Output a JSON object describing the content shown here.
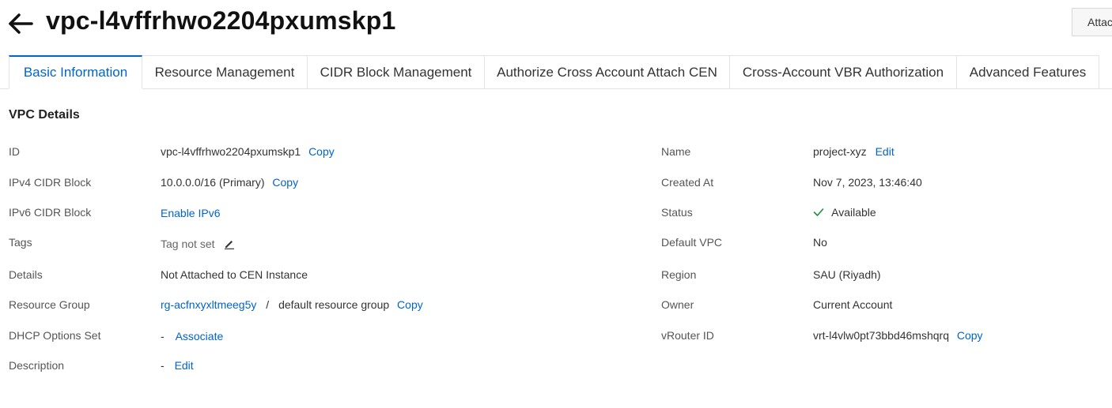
{
  "header": {
    "title": "vpc-l4vffrhwo2204pxumskp1",
    "back_icon": "arrow-left-icon",
    "attach_label": "Attac"
  },
  "tabs": [
    {
      "label": "Basic Information",
      "active": true
    },
    {
      "label": "Resource Management",
      "active": false
    },
    {
      "label": "CIDR Block Management",
      "active": false
    },
    {
      "label": "Authorize Cross Account Attach CEN",
      "active": false
    },
    {
      "label": "Cross-Account VBR Authorization",
      "active": false
    },
    {
      "label": "Advanced Features",
      "active": false
    }
  ],
  "section": {
    "title": "VPC Details"
  },
  "left": {
    "id": {
      "label": "ID",
      "value": "vpc-l4vffrhwo2204pxumskp1",
      "action": "Copy"
    },
    "ipv4": {
      "label": "IPv4 CIDR Block",
      "value": "10.0.0.0/16 (Primary)",
      "action": "Copy"
    },
    "ipv6": {
      "label": "IPv6 CIDR Block",
      "action": "Enable IPv6"
    },
    "tags": {
      "label": "Tags",
      "value": "Tag not set",
      "icon": "pencil-icon"
    },
    "details": {
      "label": "Details",
      "value": "Not Attached to CEN Instance"
    },
    "resource_group": {
      "label": "Resource Group",
      "link": "rg-acfnxyxltmeeg5y",
      "separator": "/",
      "value": "default resource group",
      "action": "Copy"
    },
    "dhcp": {
      "label": "DHCP Options Set",
      "value": "-",
      "action": "Associate"
    },
    "description": {
      "label": "Description",
      "value": "-",
      "action": "Edit"
    }
  },
  "right": {
    "name": {
      "label": "Name",
      "value": "project-xyz",
      "action": "Edit"
    },
    "created": {
      "label": "Created At",
      "value": "Nov 7, 2023, 13:46:40"
    },
    "status": {
      "label": "Status",
      "value": "Available",
      "icon": "check-icon"
    },
    "default_vpc": {
      "label": "Default VPC",
      "value": "No"
    },
    "region": {
      "label": "Region",
      "value": "SAU (Riyadh)"
    },
    "owner": {
      "label": "Owner",
      "value": "Current Account"
    },
    "vrouter": {
      "label": "vRouter ID",
      "value": "vrt-l4vlw0pt73bbd46mshqrq",
      "action": "Copy"
    }
  },
  "colors": {
    "accent": "#0064c8",
    "success": "#1e8e3e",
    "border": "#e3e4e6"
  }
}
